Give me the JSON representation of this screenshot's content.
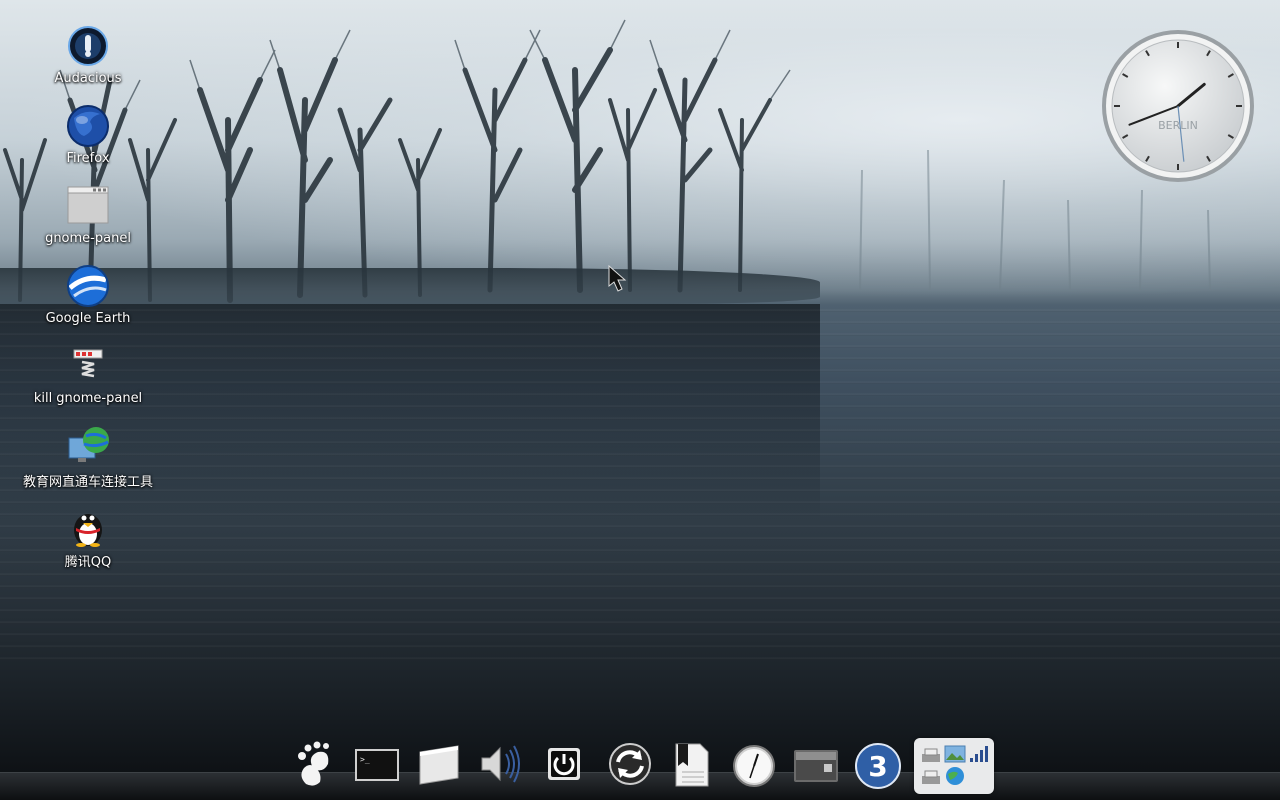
{
  "desktop": {
    "icons": [
      {
        "id": "audacious",
        "label": "Audacious",
        "icon": "audacious-icon"
      },
      {
        "id": "firefox",
        "label": "Firefox",
        "icon": "firefox-icon"
      },
      {
        "id": "gnome-panel",
        "label": "gnome-panel",
        "icon": "window-icon"
      },
      {
        "id": "google-earth",
        "label": "Google Earth",
        "icon": "google-earth-icon"
      },
      {
        "id": "kill-gnome-panel",
        "label": "kill gnome-panel",
        "icon": "kill-icon"
      },
      {
        "id": "cernet-tool",
        "label": "教育网直通车连接工具",
        "icon": "network-globe-icon"
      },
      {
        "id": "qq",
        "label": "腾讯QQ",
        "icon": "penguin-icon"
      }
    ]
  },
  "clock": {
    "city": "BERLIN",
    "time": {
      "hour": 1,
      "minute": 41,
      "second": 29
    }
  },
  "dock": {
    "items": [
      {
        "id": "gnome-menu",
        "icon": "gnome-foot-icon"
      },
      {
        "id": "terminal",
        "icon": "terminal-icon"
      },
      {
        "id": "file-manager",
        "icon": "folder-icon"
      },
      {
        "id": "volume",
        "icon": "speaker-icon"
      },
      {
        "id": "shutdown",
        "icon": "power-icon"
      },
      {
        "id": "refresh",
        "icon": "refresh-icon"
      },
      {
        "id": "documents",
        "icon": "bookmark-document-icon"
      },
      {
        "id": "clock-app",
        "icon": "clock-icon"
      },
      {
        "id": "trash",
        "icon": "trash-device-icon"
      },
      {
        "id": "workspace",
        "icon": "workspace-badge-icon",
        "number": "3"
      }
    ],
    "tray": [
      "printer-icon",
      "image-icon",
      "signal-icon",
      "printer-icon",
      "globe-icon"
    ]
  },
  "colors": {
    "label_text": "#ffffff",
    "workspace_badge": "#2f5fa6",
    "tray_bg": "#e9eaeb"
  }
}
